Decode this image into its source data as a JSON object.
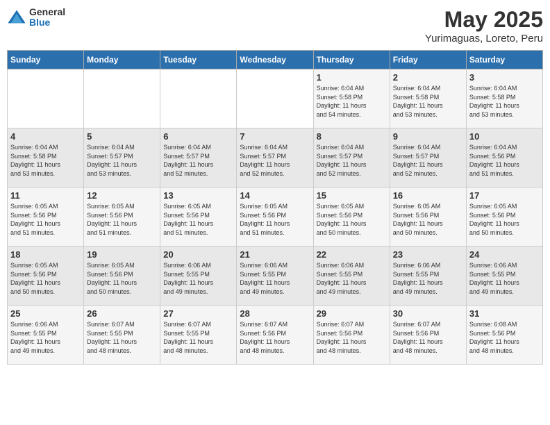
{
  "logo": {
    "general": "General",
    "blue": "Blue"
  },
  "title": "May 2025",
  "subtitle": "Yurimaguas, Loreto, Peru",
  "days_of_week": [
    "Sunday",
    "Monday",
    "Tuesday",
    "Wednesday",
    "Thursday",
    "Friday",
    "Saturday"
  ],
  "weeks": [
    [
      {
        "day": "",
        "info": ""
      },
      {
        "day": "",
        "info": ""
      },
      {
        "day": "",
        "info": ""
      },
      {
        "day": "",
        "info": ""
      },
      {
        "day": "1",
        "info": "Sunrise: 6:04 AM\nSunset: 5:58 PM\nDaylight: 11 hours\nand 54 minutes."
      },
      {
        "day": "2",
        "info": "Sunrise: 6:04 AM\nSunset: 5:58 PM\nDaylight: 11 hours\nand 53 minutes."
      },
      {
        "day": "3",
        "info": "Sunrise: 6:04 AM\nSunset: 5:58 PM\nDaylight: 11 hours\nand 53 minutes."
      }
    ],
    [
      {
        "day": "4",
        "info": "Sunrise: 6:04 AM\nSunset: 5:58 PM\nDaylight: 11 hours\nand 53 minutes."
      },
      {
        "day": "5",
        "info": "Sunrise: 6:04 AM\nSunset: 5:57 PM\nDaylight: 11 hours\nand 53 minutes."
      },
      {
        "day": "6",
        "info": "Sunrise: 6:04 AM\nSunset: 5:57 PM\nDaylight: 11 hours\nand 52 minutes."
      },
      {
        "day": "7",
        "info": "Sunrise: 6:04 AM\nSunset: 5:57 PM\nDaylight: 11 hours\nand 52 minutes."
      },
      {
        "day": "8",
        "info": "Sunrise: 6:04 AM\nSunset: 5:57 PM\nDaylight: 11 hours\nand 52 minutes."
      },
      {
        "day": "9",
        "info": "Sunrise: 6:04 AM\nSunset: 5:57 PM\nDaylight: 11 hours\nand 52 minutes."
      },
      {
        "day": "10",
        "info": "Sunrise: 6:04 AM\nSunset: 5:56 PM\nDaylight: 11 hours\nand 51 minutes."
      }
    ],
    [
      {
        "day": "11",
        "info": "Sunrise: 6:05 AM\nSunset: 5:56 PM\nDaylight: 11 hours\nand 51 minutes."
      },
      {
        "day": "12",
        "info": "Sunrise: 6:05 AM\nSunset: 5:56 PM\nDaylight: 11 hours\nand 51 minutes."
      },
      {
        "day": "13",
        "info": "Sunrise: 6:05 AM\nSunset: 5:56 PM\nDaylight: 11 hours\nand 51 minutes."
      },
      {
        "day": "14",
        "info": "Sunrise: 6:05 AM\nSunset: 5:56 PM\nDaylight: 11 hours\nand 51 minutes."
      },
      {
        "day": "15",
        "info": "Sunrise: 6:05 AM\nSunset: 5:56 PM\nDaylight: 11 hours\nand 50 minutes."
      },
      {
        "day": "16",
        "info": "Sunrise: 6:05 AM\nSunset: 5:56 PM\nDaylight: 11 hours\nand 50 minutes."
      },
      {
        "day": "17",
        "info": "Sunrise: 6:05 AM\nSunset: 5:56 PM\nDaylight: 11 hours\nand 50 minutes."
      }
    ],
    [
      {
        "day": "18",
        "info": "Sunrise: 6:05 AM\nSunset: 5:56 PM\nDaylight: 11 hours\nand 50 minutes."
      },
      {
        "day": "19",
        "info": "Sunrise: 6:05 AM\nSunset: 5:56 PM\nDaylight: 11 hours\nand 50 minutes."
      },
      {
        "day": "20",
        "info": "Sunrise: 6:06 AM\nSunset: 5:55 PM\nDaylight: 11 hours\nand 49 minutes."
      },
      {
        "day": "21",
        "info": "Sunrise: 6:06 AM\nSunset: 5:55 PM\nDaylight: 11 hours\nand 49 minutes."
      },
      {
        "day": "22",
        "info": "Sunrise: 6:06 AM\nSunset: 5:55 PM\nDaylight: 11 hours\nand 49 minutes."
      },
      {
        "day": "23",
        "info": "Sunrise: 6:06 AM\nSunset: 5:55 PM\nDaylight: 11 hours\nand 49 minutes."
      },
      {
        "day": "24",
        "info": "Sunrise: 6:06 AM\nSunset: 5:55 PM\nDaylight: 11 hours\nand 49 minutes."
      }
    ],
    [
      {
        "day": "25",
        "info": "Sunrise: 6:06 AM\nSunset: 5:55 PM\nDaylight: 11 hours\nand 49 minutes."
      },
      {
        "day": "26",
        "info": "Sunrise: 6:07 AM\nSunset: 5:55 PM\nDaylight: 11 hours\nand 48 minutes."
      },
      {
        "day": "27",
        "info": "Sunrise: 6:07 AM\nSunset: 5:55 PM\nDaylight: 11 hours\nand 48 minutes."
      },
      {
        "day": "28",
        "info": "Sunrise: 6:07 AM\nSunset: 5:56 PM\nDaylight: 11 hours\nand 48 minutes."
      },
      {
        "day": "29",
        "info": "Sunrise: 6:07 AM\nSunset: 5:56 PM\nDaylight: 11 hours\nand 48 minutes."
      },
      {
        "day": "30",
        "info": "Sunrise: 6:07 AM\nSunset: 5:56 PM\nDaylight: 11 hours\nand 48 minutes."
      },
      {
        "day": "31",
        "info": "Sunrise: 6:08 AM\nSunset: 5:56 PM\nDaylight: 11 hours\nand 48 minutes."
      }
    ]
  ]
}
